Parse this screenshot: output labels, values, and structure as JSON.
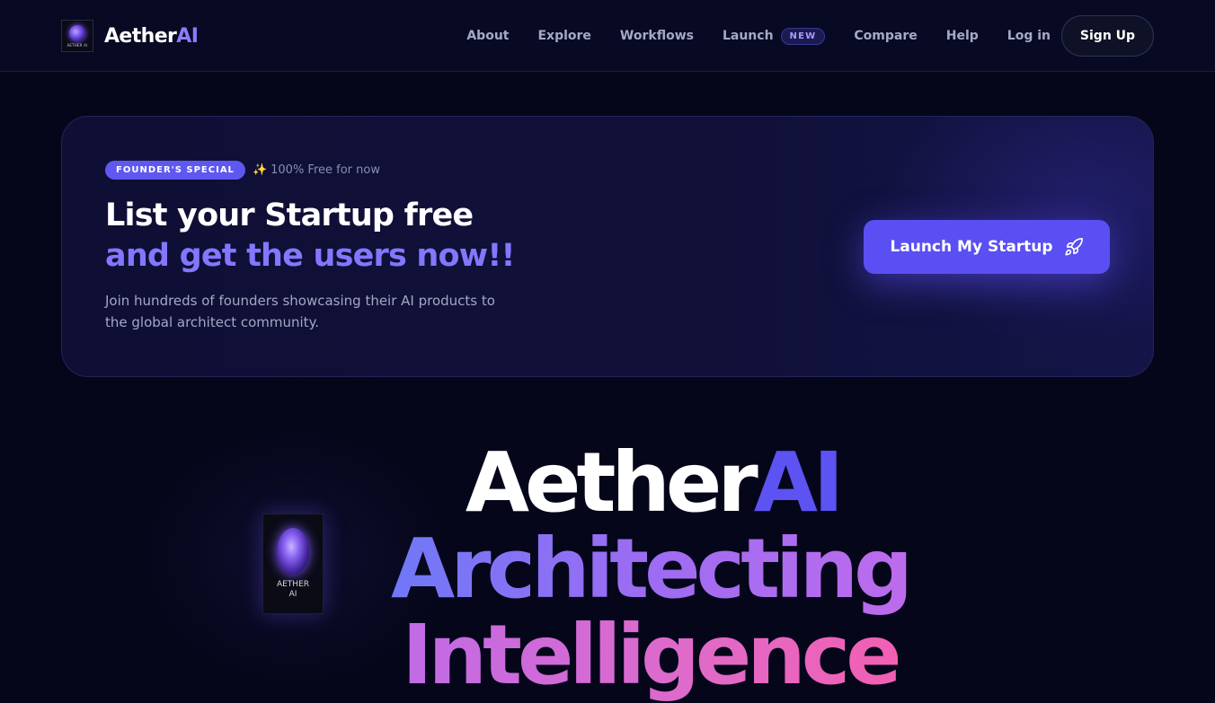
{
  "nav": {
    "logo_caption": "AETHER AI",
    "brand_main": "Aether",
    "brand_accent": "AI",
    "links": [
      "About",
      "Explore",
      "Workflows"
    ],
    "launch_label": "Launch",
    "launch_badge": "NEW",
    "links_after": [
      "Compare",
      "Help"
    ],
    "login_label": "Log in",
    "signup_label": "Sign Up"
  },
  "promo": {
    "pill": "FOUNDER'S SPECIAL",
    "sparkle_icon": "sparkle-icon",
    "free_note": "100% Free for now",
    "headline_1": "List your Startup free",
    "headline_2": "and get the users now!!",
    "description": "Join hundreds of founders showcasing their AI products to the global architect community.",
    "cta_label": "Launch My Startup",
    "cta_icon": "rocket-icon"
  },
  "hero": {
    "card_caption_1": "AETHER",
    "card_caption_2": "AI",
    "title_main": "Aether",
    "title_accent": "AI",
    "line_2": "Architecting",
    "line_3": "Intelligence"
  },
  "colors": {
    "background": "#05061a",
    "accent": "#5a4ff2",
    "accent_text": "#8576ff",
    "gradient_start": "#6f78f7",
    "gradient_end": "#f25fb2"
  }
}
